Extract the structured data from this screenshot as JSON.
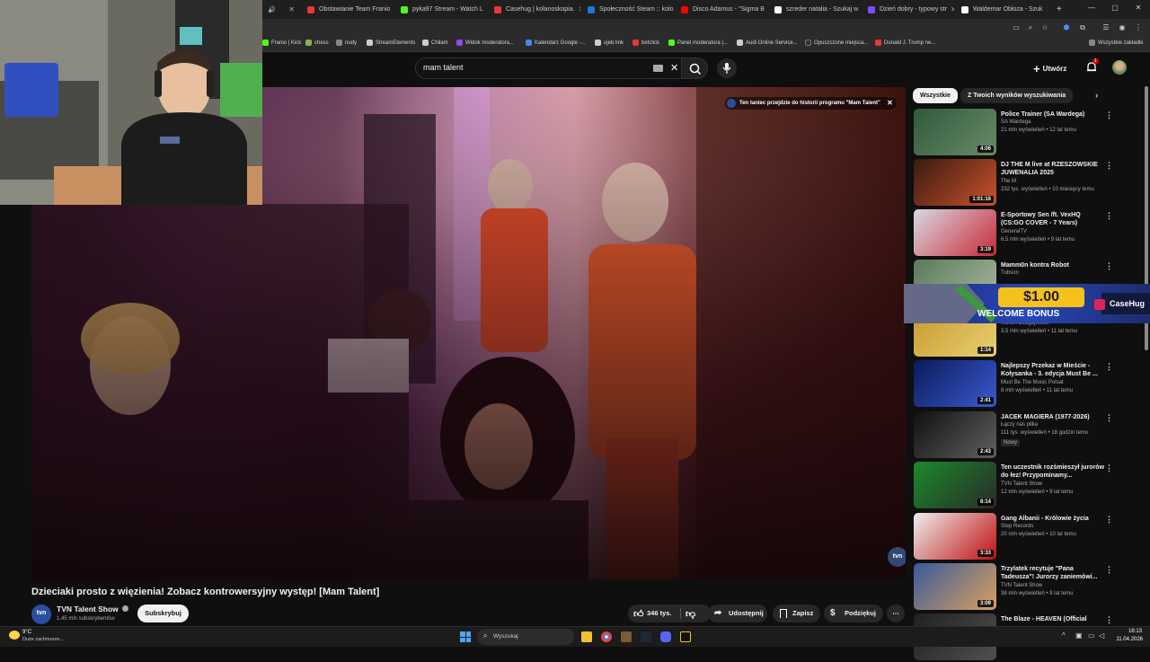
{
  "browser": {
    "tabs": [
      {
        "label": "Obstawianie Team Franio",
        "color": "#e53935"
      },
      {
        "label": "pyka97 Stream - Watch L",
        "color": "#53fc18"
      },
      {
        "label": "Casehug | kolanoskopia.",
        "color": "#e53935"
      },
      {
        "label": "Społeczność Steam :: kolo",
        "color": "#1b77d2"
      },
      {
        "label": "Disco Adamus - \"Sigma B",
        "color": "#ff0000"
      },
      {
        "label": "szreder natalia - Szukaj w",
        "color": "#ffffff"
      },
      {
        "label": "Dzień dobry - typowy str",
        "color": "#7c4dff"
      },
      {
        "label": "Waldemar Obłoza - Szuk",
        "color": "#ffffff"
      }
    ],
    "bookmarks": [
      {
        "label": "Franio | Kick",
        "color": "#53fc18"
      },
      {
        "label": "chess",
        "color": "#81b64c"
      },
      {
        "label": "nudy",
        "color": "#cccccc"
      },
      {
        "label": "StreamElements",
        "color": "#cccccc"
      },
      {
        "label": "Chiłam",
        "color": "#cccccc"
      },
      {
        "label": "Widok moderatora...",
        "color": "#9146ff"
      },
      {
        "label": "Kalendarz Google -...",
        "color": "#4285f4"
      },
      {
        "label": "ujeb link",
        "color": "#cccccc"
      },
      {
        "label": "betclick",
        "color": "#e53935"
      },
      {
        "label": "Panel moderatora |...",
        "color": "#53fc18"
      },
      {
        "label": "Audi Online Service...",
        "color": "#cccccc"
      },
      {
        "label": "Opuszczone miejsca...",
        "color": "#333333"
      },
      {
        "label": "Donald J. Trump ne...",
        "color": "#e53935"
      }
    ],
    "all_bookmarks": "Wszystkie zakładki"
  },
  "youtube": {
    "search_value": "mam talent",
    "create_label": "Utwórz",
    "notif_count": "1",
    "video_banner": "Ten taniec przejdzie do historii programu \"Mam Talent\"",
    "video_title": "Dzieciaki prosto z więzienia! Zobacz kontrowersyjny występ! [Mam Talent]",
    "channel": {
      "name": "TVN Talent Show",
      "subs": "1,45 mln subskrybentów",
      "avatar_text": "tvn"
    },
    "subscribe": "Subskrybuj",
    "likes": "346 tys.",
    "share": "Udostępnij",
    "save": "Zapisz",
    "thanks": "Podziękuj",
    "watermark": "tvn",
    "chips": [
      "Wszystkie",
      "Z Twoich wyników wyszukiwania"
    ],
    "recs": [
      {
        "title": "Police Trainer (SA Wardega)",
        "channel": "SA Wardega",
        "meta": "21 mln wyświetleń • 12 lat temu",
        "dur": "4:06",
        "c1": "#2f5a3a",
        "c2": "#6a8a6a"
      },
      {
        "title": "DJ THE M live at RZESZOWSKIE JUWENALIA 2025",
        "channel": "The M",
        "meta": "232 tys. wyświetleń • 10 miesięcy temu",
        "dur": "1:01:16",
        "c1": "#3a1a10",
        "c2": "#c8522a"
      },
      {
        "title": "E-Sportowy Sen /ft. VexHQ (CS:GO COVER - 7 Years)",
        "channel": "GeneralTV",
        "meta": "6,5 mln wyświetleń • 9 lat temu",
        "dur": "3:19",
        "c1": "#d8d8e0",
        "c2": "#c82a3a"
      },
      {
        "title": "Mamm0n kontra Robot",
        "channel": "Tubson",
        "meta": "",
        "dur": "",
        "c1": "#5a7a5a",
        "c2": "#a8b8a0"
      },
      {
        "title": "",
        "channel": "Marcin Dzugajewski",
        "meta": "3,5 mln wyświetleń • 11 lat temu",
        "dur": "1:14",
        "c1": "#c89a30",
        "c2": "#e8d070"
      },
      {
        "title": "Najlepszy Przekaz w Mieście - Kołysanka - 3. edycja Must Be ...",
        "channel": "Must Be The Music Polsat",
        "meta": "8 mln wyświetleń • 11 lat temu",
        "dur": "2:41",
        "c1": "#0a1a5a",
        "c2": "#3a5ad0"
      },
      {
        "title": "JACEK MAGIERA (1977-2026)",
        "channel": "Łączy nas piłka",
        "meta": "111 tys. wyświetleń • 18 godzin temu",
        "dur": "2:43",
        "badge": "Nowy",
        "c1": "#101010",
        "c2": "#606060"
      },
      {
        "title": "Ten uczestnik rozśmieszył jurorów do łez! Przypominamy...",
        "channel": "TVN Talent Show",
        "meta": "12 mln wyświetleń • 9 lat temu",
        "dur": "8:14",
        "c1": "#1a8a2a",
        "c2": "#2a2a2a"
      },
      {
        "title": "Gang Albanii - Królowie życia",
        "channel": "Step Records",
        "meta": "20 mln wyświetleń • 10 lat temu",
        "dur": "3:33",
        "c1": "#eeeeee",
        "c2": "#c01010"
      },
      {
        "title": "Trzylatek recytuje \"Pana Tadeusza\"! Jurorzy zaniemówi...",
        "channel": "TVN Talent Show",
        "meta": "38 mln wyświetleń • 9 lat temu",
        "dur": "3:09",
        "c1": "#3a5a9a",
        "c2": "#d8a060"
      },
      {
        "title": "The Blaze - HEAVEN (Official",
        "channel": "",
        "meta": "",
        "dur": "",
        "c1": "#202020",
        "c2": "#505050"
      }
    ],
    "ad": {
      "amount": "$1.00",
      "text": "WELCOME BONUS",
      "brand": "CaseHug"
    }
  },
  "taskbar": {
    "weather_temp": "9°C",
    "weather_desc": "Duże zachmurze...",
    "search": "Wyszukaj",
    "time": "16:13",
    "date": "11.04.2026"
  }
}
